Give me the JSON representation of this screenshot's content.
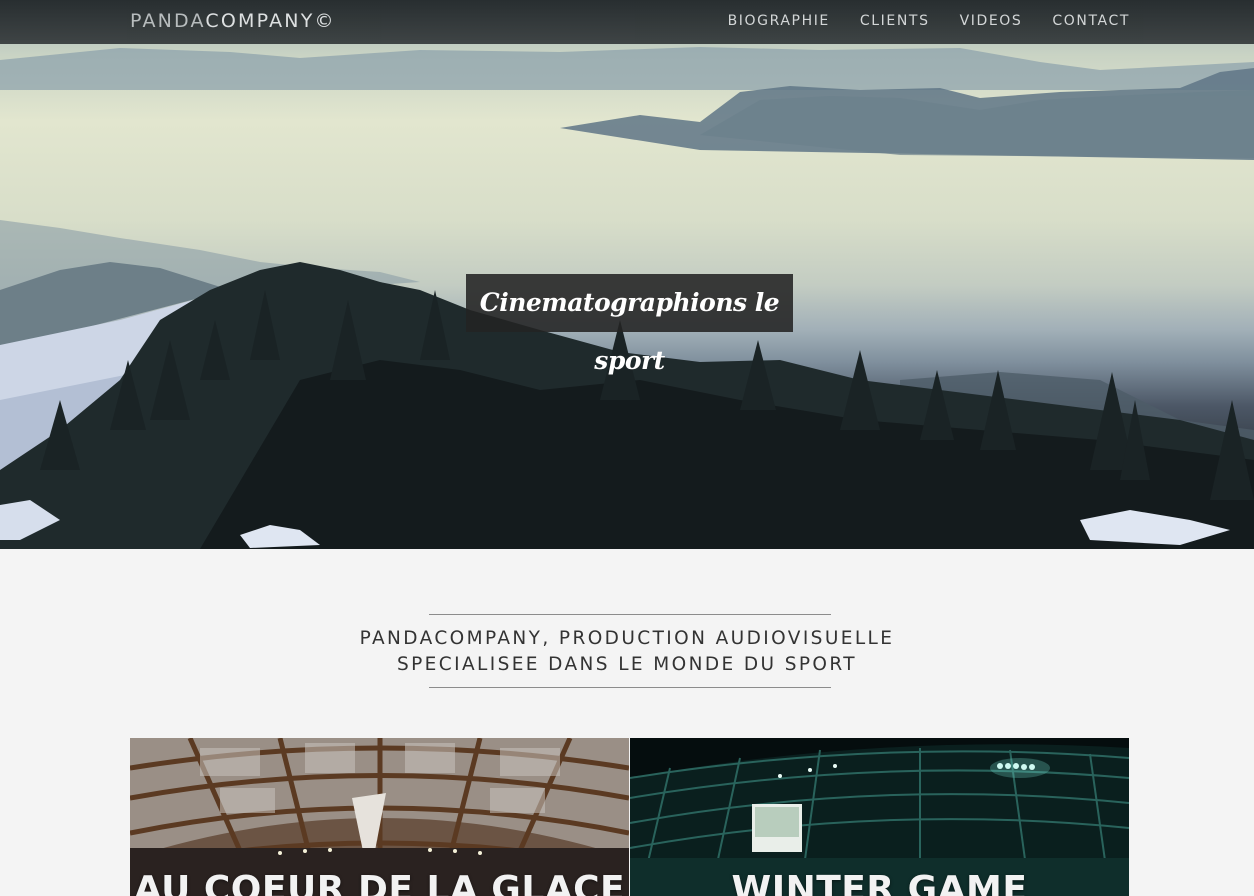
{
  "brand": {
    "thin": "PANDA",
    "bold": "COMPANY©"
  },
  "nav": {
    "items": [
      {
        "label": "BIOGRAPHIE"
      },
      {
        "label": "CLIENTS"
      },
      {
        "label": "VIDEOS"
      },
      {
        "label": "CONTACT"
      }
    ]
  },
  "hero": {
    "tagline": "Cinematographions le sport"
  },
  "intro": {
    "line1": "PANDACOMPANY, PRODUCTION AUDIOVISUELLE",
    "line2": "SPECIALISEE DANS LE MONDE DU SPORT"
  },
  "cards": [
    {
      "title": "AU COEUR DE LA GLACE"
    },
    {
      "title": "WINTER GAME"
    }
  ],
  "colors": {
    "nav_bg": "#2a2f31",
    "page_bg": "#f4f4f4",
    "tagline_bg": "#232323"
  }
}
